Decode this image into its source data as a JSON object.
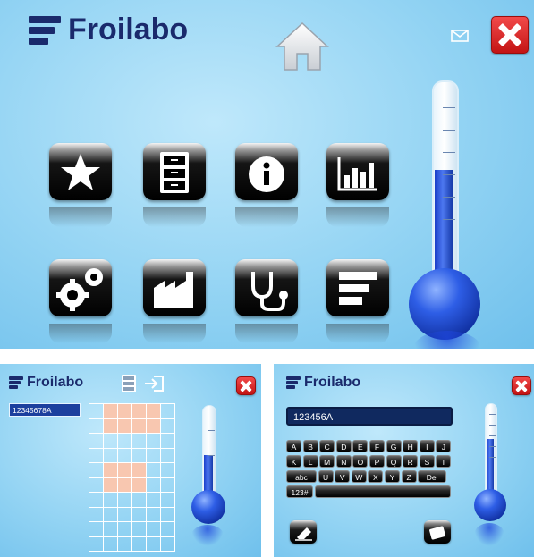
{
  "main": {
    "brand": "Froilabo",
    "icons": {
      "home": "home-icon",
      "mail": "mail-icon",
      "close": "close-icon"
    },
    "tiles": [
      {
        "name": "favorites-tile",
        "icon": "star-icon"
      },
      {
        "name": "storage-tile",
        "icon": "cabinet-icon"
      },
      {
        "name": "info-tile",
        "icon": "info-icon"
      },
      {
        "name": "statistics-tile",
        "icon": "bar-chart-icon"
      },
      {
        "name": "settings-tile",
        "icon": "gears-icon"
      },
      {
        "name": "factory-tile",
        "icon": "factory-icon"
      },
      {
        "name": "maintenance-tile",
        "icon": "stethoscope-icon"
      },
      {
        "name": "brand-tile",
        "icon": "froilabo-logo-icon"
      }
    ]
  },
  "storage": {
    "brand": "Froilabo",
    "sample_id": "12345678A",
    "grid": {
      "columns": 6,
      "rows": 10,
      "occupied": [
        [
          0,
          1
        ],
        [
          0,
          2
        ],
        [
          0,
          3
        ],
        [
          0,
          4
        ],
        [
          1,
          1
        ],
        [
          1,
          2
        ],
        [
          1,
          3
        ],
        [
          1,
          4
        ],
        [
          4,
          1
        ],
        [
          4,
          2
        ],
        [
          4,
          3
        ],
        [
          5,
          1
        ],
        [
          5,
          2
        ],
        [
          5,
          3
        ]
      ]
    },
    "colors": {
      "occupied": "#f8c7b0",
      "field": "#1c3f9e"
    }
  },
  "keyboard": {
    "brand": "Froilabo",
    "input_value": "123456A",
    "rows": [
      [
        "A",
        "B",
        "C",
        "D",
        "E",
        "F",
        "G",
        "H",
        "I",
        "J"
      ],
      [
        "K",
        "L",
        "M",
        "N",
        "O",
        "P",
        "Q",
        "R",
        "S",
        "T"
      ],
      [
        "abc",
        "U",
        "V",
        "W",
        "X",
        "Y",
        "Z",
        "Del"
      ],
      [
        "123#"
      ]
    ]
  },
  "colors": {
    "accent": "#1a2a6c",
    "close": "#d61f1f",
    "mercury": "#2e5ee6"
  }
}
